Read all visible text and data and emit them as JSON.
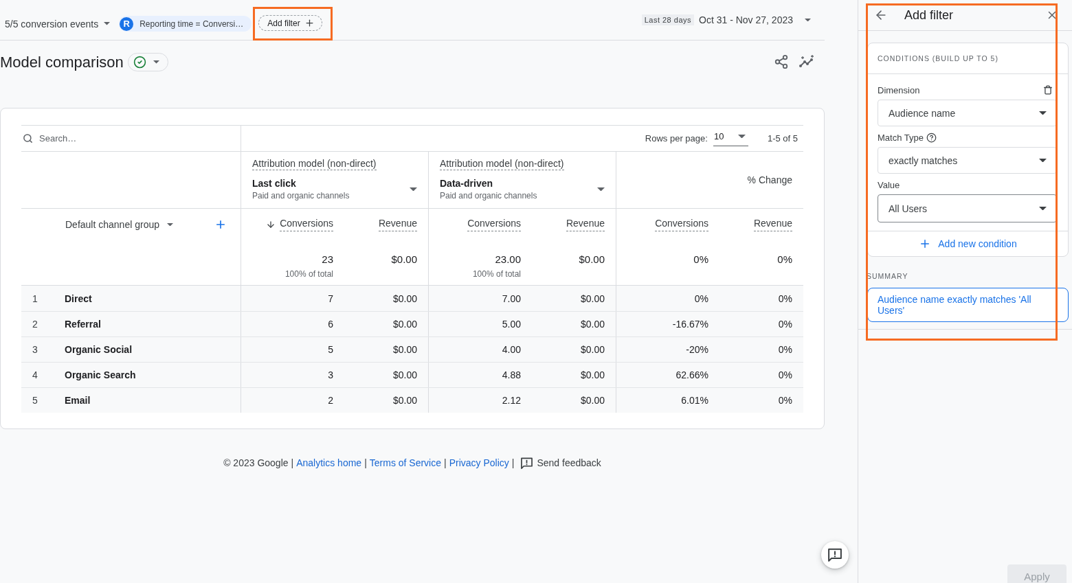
{
  "toolbar": {
    "events_selector": "5/5 conversion events",
    "filter_chip": {
      "avatar": "R",
      "label": "Reporting time = Conversi…"
    },
    "add_filter": {
      "label": "Add filter",
      "highlighted": true
    },
    "date_range": {
      "preset": "Last 28 days",
      "range": "Oct 31 - Nov 27, 2023"
    }
  },
  "report": {
    "title": "Model comparison"
  },
  "table": {
    "search": {
      "placeholder": "Search…"
    },
    "rows_per_page": {
      "label": "Rows per page:",
      "value": "10"
    },
    "pagination": "1-5 of 5",
    "dimension": "Default channel group",
    "groups": [
      {
        "kind": "model",
        "heading": "Attribution model (non-direct)",
        "model": "Last click",
        "scope": "Paid and organic channels"
      },
      {
        "kind": "model",
        "heading": "Attribution model (non-direct)",
        "model": "Data-driven",
        "scope": "Paid and organic channels"
      },
      {
        "kind": "change",
        "heading": "% Change"
      }
    ],
    "columns": [
      {
        "label": "Conversions",
        "sorted": true
      },
      {
        "label": "Revenue",
        "sorted": false
      },
      {
        "label": "Conversions",
        "sorted": false
      },
      {
        "label": "Revenue",
        "sorted": false
      },
      {
        "label": "Conversions",
        "sorted": false
      },
      {
        "label": "Revenue",
        "sorted": false
      }
    ],
    "totals": [
      {
        "value": "23",
        "note": "100% of total"
      },
      {
        "value": "$0.00"
      },
      {
        "value": "23.00",
        "note": "100% of total"
      },
      {
        "value": "$0.00"
      },
      {
        "value": "0%"
      },
      {
        "value": "0%"
      }
    ],
    "rows": [
      {
        "index": "1",
        "channel": "Direct",
        "cells": [
          "7",
          "$0.00",
          "7.00",
          "$0.00",
          "0%",
          "0%"
        ]
      },
      {
        "index": "2",
        "channel": "Referral",
        "cells": [
          "6",
          "$0.00",
          "5.00",
          "$0.00",
          "-16.67%",
          "0%"
        ]
      },
      {
        "index": "3",
        "channel": "Organic Social",
        "cells": [
          "5",
          "$0.00",
          "4.00",
          "$0.00",
          "-20%",
          "0%"
        ]
      },
      {
        "index": "4",
        "channel": "Organic Search",
        "cells": [
          "3",
          "$0.00",
          "4.88",
          "$0.00",
          "62.66%",
          "0%"
        ]
      },
      {
        "index": "5",
        "channel": "Email",
        "cells": [
          "2",
          "$0.00",
          "2.12",
          "$0.00",
          "6.01%",
          "0%"
        ]
      }
    ]
  },
  "panel": {
    "title": "Add filter",
    "highlighted": true,
    "conditions_heading": "CONDITIONS (BUILD UP TO 5)",
    "fields": [
      {
        "label": "Dimension",
        "value": "Audience name",
        "help": false,
        "focused": false
      },
      {
        "label": "Match Type",
        "value": "exactly matches",
        "help": true,
        "focused": false
      },
      {
        "label": "Value",
        "value": "All Users",
        "help": false,
        "focused": true
      }
    ],
    "add_condition": "Add new condition",
    "summary_heading": "SUMMARY",
    "summary": "Audience name exactly matches 'All Users'",
    "apply": {
      "label": "Apply",
      "disabled": true
    }
  },
  "footer": {
    "items": [
      {
        "kind": "text",
        "text": "© 2023 Google"
      },
      {
        "kind": "separator",
        "text": "|"
      },
      {
        "kind": "link",
        "text": "Analytics home"
      },
      {
        "kind": "separator",
        "text": "|"
      },
      {
        "kind": "link",
        "text": "Terms of Service"
      },
      {
        "kind": "separator",
        "text": "|"
      },
      {
        "kind": "link",
        "text": "Privacy Policy"
      },
      {
        "kind": "separator",
        "text": "|"
      },
      {
        "kind": "feedback",
        "text": "Send feedback"
      }
    ]
  }
}
